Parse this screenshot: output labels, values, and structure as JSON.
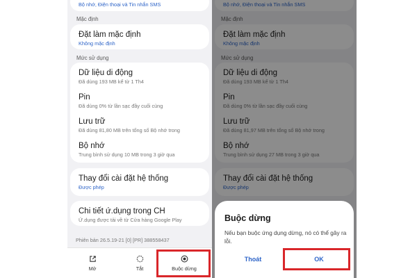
{
  "left": {
    "top_partial": "Bộ nhớ, Điện thoại và Tin nhắn SMS",
    "default_section": "Mặc định",
    "default_item": {
      "title": "Đặt làm mặc định",
      "sub": "Không mặc định"
    },
    "usage_section": "Mức sử dụng",
    "usage_items": [
      {
        "title": "Dữ liệu di động",
        "sub": "Đã dùng 193 MB kể từ 1 Th4"
      },
      {
        "title": "Pin",
        "sub": "Đã dùng 0% từ lần sạc đầy cuối cùng"
      },
      {
        "title": "Lưu trữ",
        "sub": "Đã dùng 81,80 MB trên tổng số Bộ nhớ trong"
      },
      {
        "title": "Bộ nhớ",
        "sub": "Trung bình sử dụng 10 MB trong 3 giờ qua"
      }
    ],
    "system_item": {
      "title": "Thay đổi cài đặt hệ thống",
      "sub": "Được phép"
    },
    "details_item": {
      "title": "Chi tiết ứ.dụng trong CH",
      "sub": "Ứ.dụng được tải về từ Cửa hàng Google Play"
    },
    "version": "Phiên bản 26.5.19-21 [0] [PR] 388558437",
    "bottom_bar": {
      "open": {
        "label": "Mở",
        "icon": "open-external-icon"
      },
      "disable": {
        "label": "Tắt",
        "icon": "disable-circle-icon"
      },
      "force_stop": {
        "label": "Buộc dừng",
        "icon": "stop-circle-icon"
      }
    }
  },
  "right": {
    "top_partial": "Bộ nhớ, Điện thoại và Tin nhắn SMS",
    "default_section": "Mặc định",
    "default_item": {
      "title": "Đặt làm mặc định",
      "sub": "Không mặc định"
    },
    "usage_section": "Mức sử dụng",
    "usage_items": [
      {
        "title": "Dữ liệu di động",
        "sub": "Đã dùng 193 MB kể từ 1 Th4"
      },
      {
        "title": "Pin",
        "sub": "Đã dùng 0% từ lần sạc đầy cuối cùng"
      },
      {
        "title": "Lưu trữ",
        "sub": "Đã dùng 81,97 MB trên tổng số Bộ nhớ trong"
      },
      {
        "title": "Bộ nhớ",
        "sub": "Trung bình sử dụng 27 MB trong 3 giờ qua"
      }
    ],
    "system_item": {
      "title": "Thay đổi cài đặt hệ thống",
      "sub": "Được phép"
    },
    "dialog": {
      "title": "Buộc dừng",
      "message": "Nếu bạn buộc ứng dụng dừng, nó có thể gây ra lỗi.",
      "cancel": "Thoát",
      "ok": "OK"
    }
  },
  "colors": {
    "accent_link": "#2d64c8",
    "highlight": "#d9262a",
    "card": "#ffffff",
    "page": "#f1f1f4"
  }
}
